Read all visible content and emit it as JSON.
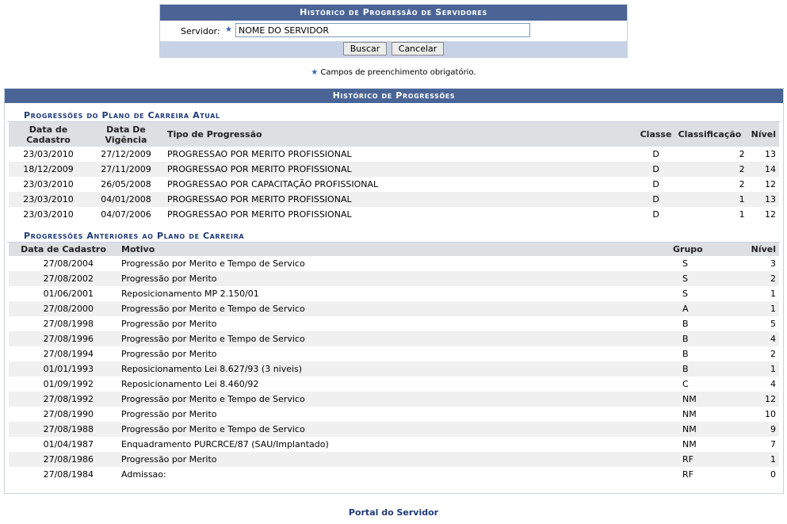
{
  "search_form": {
    "title": "Histórico de Progressão de Servidores",
    "servidor_label": "Servidor:",
    "servidor_value": "NOME DO SERVIDOR",
    "search_button": "Buscar",
    "cancel_button": "Cancelar"
  },
  "required_note": "Campos de preenchimento obrigatório.",
  "history": {
    "title": "Histórico de Progressões",
    "current_plan": {
      "title": "Progressões do Plano de Carreira Atual",
      "headers": {
        "data_cadastro": "Data de Cadastro",
        "data_vigencia": "Data De Vigência",
        "tipo": "Tipo de Progressão",
        "classe": "Classe",
        "classificacao": "Classificação",
        "nivel": "Nível"
      },
      "rows": [
        {
          "data_cadastro": "23/03/2010",
          "data_vigencia": "27/12/2009",
          "tipo": "PROGRESSAO POR MERITO PROFISSIONAL",
          "classe": "D",
          "classificacao": "2",
          "nivel": "13"
        },
        {
          "data_cadastro": "18/12/2009",
          "data_vigencia": "27/11/2009",
          "tipo": "PROGRESSAO POR MERITO PROFISSIONAL",
          "classe": "D",
          "classificacao": "2",
          "nivel": "14"
        },
        {
          "data_cadastro": "23/03/2010",
          "data_vigencia": "26/05/2008",
          "tipo": "PROGRESSAO POR CAPACITAÇÃO PROFISSIONAL",
          "classe": "D",
          "classificacao": "2",
          "nivel": "12"
        },
        {
          "data_cadastro": "23/03/2010",
          "data_vigencia": "04/01/2008",
          "tipo": "PROGRESSAO POR MERITO PROFISSIONAL",
          "classe": "D",
          "classificacao": "1",
          "nivel": "13"
        },
        {
          "data_cadastro": "23/03/2010",
          "data_vigencia": "04/07/2006",
          "tipo": "PROGRESSAO POR MERITO PROFISSIONAL",
          "classe": "D",
          "classificacao": "1",
          "nivel": "12"
        }
      ]
    },
    "previous_plan": {
      "title": "Progressões Anteriores ao Plano de Carreira",
      "headers": {
        "data_cadastro": "Data de Cadastro",
        "motivo": "Motivo",
        "grupo": "Grupo",
        "nivel": "Nível"
      },
      "rows": [
        {
          "data_cadastro": "27/08/2004",
          "motivo": "Progressão por Merito e Tempo de Servico",
          "grupo": "S",
          "nivel": "3"
        },
        {
          "data_cadastro": "27/08/2002",
          "motivo": "Progressão por Merito",
          "grupo": "S",
          "nivel": "2"
        },
        {
          "data_cadastro": "01/06/2001",
          "motivo": "Reposicionamento MP 2.150/01",
          "grupo": "S",
          "nivel": "1"
        },
        {
          "data_cadastro": "27/08/2000",
          "motivo": "Progressão por Merito e Tempo de Servico",
          "grupo": "A",
          "nivel": "1"
        },
        {
          "data_cadastro": "27/08/1998",
          "motivo": "Progressão por Merito",
          "grupo": "B",
          "nivel": "5"
        },
        {
          "data_cadastro": "27/08/1996",
          "motivo": "Progressão por Merito e Tempo de Servico",
          "grupo": "B",
          "nivel": "4"
        },
        {
          "data_cadastro": "27/08/1994",
          "motivo": "Progressão por Merito",
          "grupo": "B",
          "nivel": "2"
        },
        {
          "data_cadastro": "01/01/1993",
          "motivo": "Reposicionamento Lei 8.627/93 (3 niveis)",
          "grupo": "B",
          "nivel": "1"
        },
        {
          "data_cadastro": "01/09/1992",
          "motivo": "Reposicionamento Lei 8.460/92",
          "grupo": "C",
          "nivel": "4"
        },
        {
          "data_cadastro": "27/08/1992",
          "motivo": "Progressão por Merito e Tempo de Servico",
          "grupo": "NM",
          "nivel": "12"
        },
        {
          "data_cadastro": "27/08/1990",
          "motivo": "Progressão por Merito",
          "grupo": "NM",
          "nivel": "10"
        },
        {
          "data_cadastro": "27/08/1988",
          "motivo": "Progressão por Merito e Tempo de Servico",
          "grupo": "NM",
          "nivel": "9"
        },
        {
          "data_cadastro": "01/04/1987",
          "motivo": "Enquadramento PURCRCE/87 (SAU/Implantado)",
          "grupo": "NM",
          "nivel": "7"
        },
        {
          "data_cadastro": "27/08/1986",
          "motivo": "Progressão por Merito",
          "grupo": "RF",
          "nivel": "1"
        },
        {
          "data_cadastro": "27/08/1984",
          "motivo": "Admissao:",
          "grupo": "RF",
          "nivel": "0"
        }
      ]
    }
  },
  "footer_link": "Portal do Servidor"
}
